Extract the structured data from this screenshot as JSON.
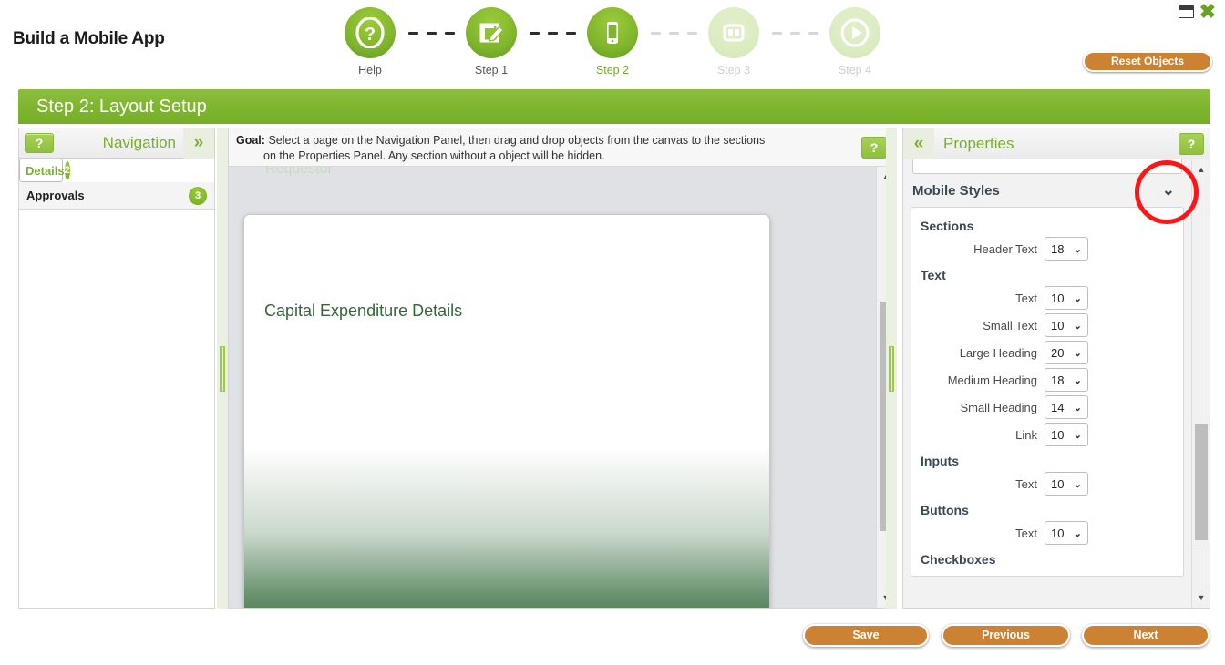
{
  "window": {
    "restore_icon": "restore-icon",
    "close_icon": "close-icon"
  },
  "header": {
    "title": "Build a Mobile App",
    "reset_label": "Reset Objects",
    "accent_green": "#7fb630",
    "accent_orange": "#cd8233"
  },
  "stepper": {
    "steps": [
      {
        "label": "Help",
        "icon": "question-circle-icon",
        "state": "done"
      },
      {
        "label": "Step 1",
        "icon": "edit-note-icon",
        "state": "done"
      },
      {
        "label": "Step 2",
        "icon": "mobile-phone-icon",
        "state": "current"
      },
      {
        "label": "Step 3",
        "icon": "layout-columns-icon",
        "state": "disabled"
      },
      {
        "label": "Step 4",
        "icon": "play-circle-icon",
        "state": "disabled"
      }
    ]
  },
  "section": {
    "title": "Step 2: Layout Setup"
  },
  "navigation": {
    "help_label": "?",
    "title": "Navigation",
    "expand_icon": "chevron-double-right-icon",
    "items": [
      {
        "label": "Details",
        "count": "2",
        "selected": true
      },
      {
        "label": "Approvals",
        "count": "3",
        "selected": false
      }
    ]
  },
  "canvas": {
    "goal_label": "Goal:",
    "goal_line1": "Select a page on the Navigation Panel, then drag and drop objects from the canvas to the sections",
    "goal_line2": "on the Properties Panel. Any section without a object will be hidden.",
    "help_label": "?",
    "ghost_label": "Requestor",
    "phone_heading": "Capital Expenditure Details",
    "scroll_up_icon": "triangle-up-icon",
    "scroll_down_icon": "triangle-down-icon"
  },
  "properties": {
    "collapse_icon": "chevron-double-left-icon",
    "title": "Properties",
    "help_label": "?",
    "group_title": "Mobile Styles",
    "group_chevron_icon": "chevron-down-icon",
    "categories": [
      {
        "name": "Sections",
        "rows": [
          {
            "label": "Header Text",
            "value": "18"
          }
        ]
      },
      {
        "name": "Text",
        "rows": [
          {
            "label": "Text",
            "value": "10"
          },
          {
            "label": "Small Text",
            "value": "10"
          },
          {
            "label": "Large Heading",
            "value": "20"
          },
          {
            "label": "Medium Heading",
            "value": "18"
          },
          {
            "label": "Small Heading",
            "value": "14"
          },
          {
            "label": "Link",
            "value": "10"
          }
        ]
      },
      {
        "name": "Inputs",
        "rows": [
          {
            "label": "Text",
            "value": "10"
          }
        ]
      },
      {
        "name": "Buttons",
        "rows": [
          {
            "label": "Text",
            "value": "10"
          }
        ]
      },
      {
        "name": "Checkboxes",
        "rows": []
      }
    ],
    "scroll_up_icon": "triangle-up-icon",
    "scroll_down_icon": "triangle-down-icon"
  },
  "footer": {
    "save_label": "Save",
    "previous_label": "Previous",
    "next_label": "Next"
  }
}
